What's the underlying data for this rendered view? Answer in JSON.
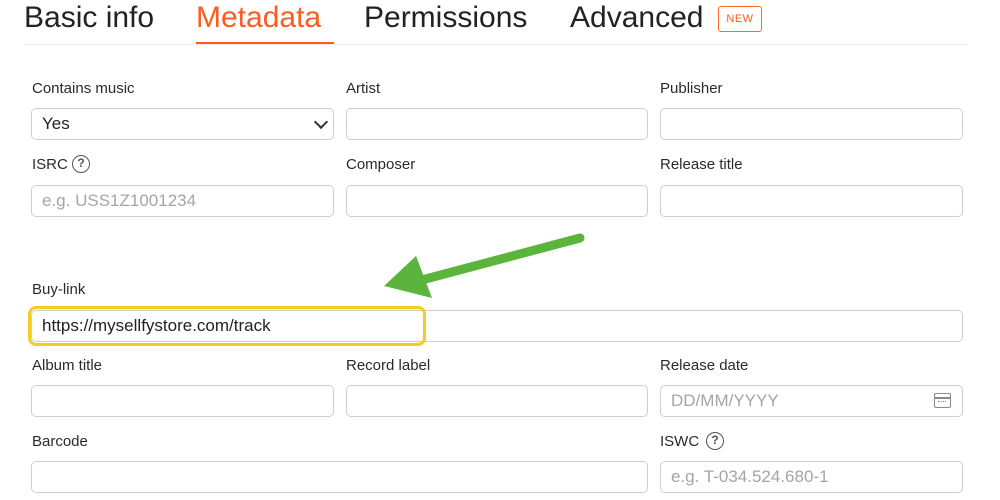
{
  "tabs": {
    "basic_info": "Basic info",
    "metadata": "Metadata",
    "permissions": "Permissions",
    "advanced": "Advanced",
    "new_badge": "NEW"
  },
  "active_tab": "metadata",
  "colors": {
    "accent": "#ff5a1f",
    "highlight": "#f3cd23",
    "arrow": "#5bb53d"
  },
  "form": {
    "contains_music": {
      "label": "Contains music",
      "value": "Yes"
    },
    "artist": {
      "label": "Artist",
      "value": ""
    },
    "publisher": {
      "label": "Publisher",
      "value": ""
    },
    "isrc": {
      "label": "ISRC",
      "placeholder": "e.g. USS1Z1001234",
      "help_icon": "question-circle-icon"
    },
    "composer": {
      "label": "Composer",
      "value": ""
    },
    "release_title": {
      "label": "Release title",
      "value": ""
    },
    "buy_link": {
      "label": "Buy-link",
      "value": "https://mysellfystore.com/track"
    },
    "album_title": {
      "label": "Album title",
      "value": ""
    },
    "record_label": {
      "label": "Record label",
      "value": ""
    },
    "release_date": {
      "label": "Release date",
      "placeholder": "DD/MM/YYYY",
      "icon": "calendar-icon"
    },
    "barcode": {
      "label": "Barcode",
      "value": ""
    },
    "iswc": {
      "label": "ISWC",
      "placeholder": "e.g. T-034.524.680-1",
      "help_icon": "question-circle-icon"
    }
  }
}
